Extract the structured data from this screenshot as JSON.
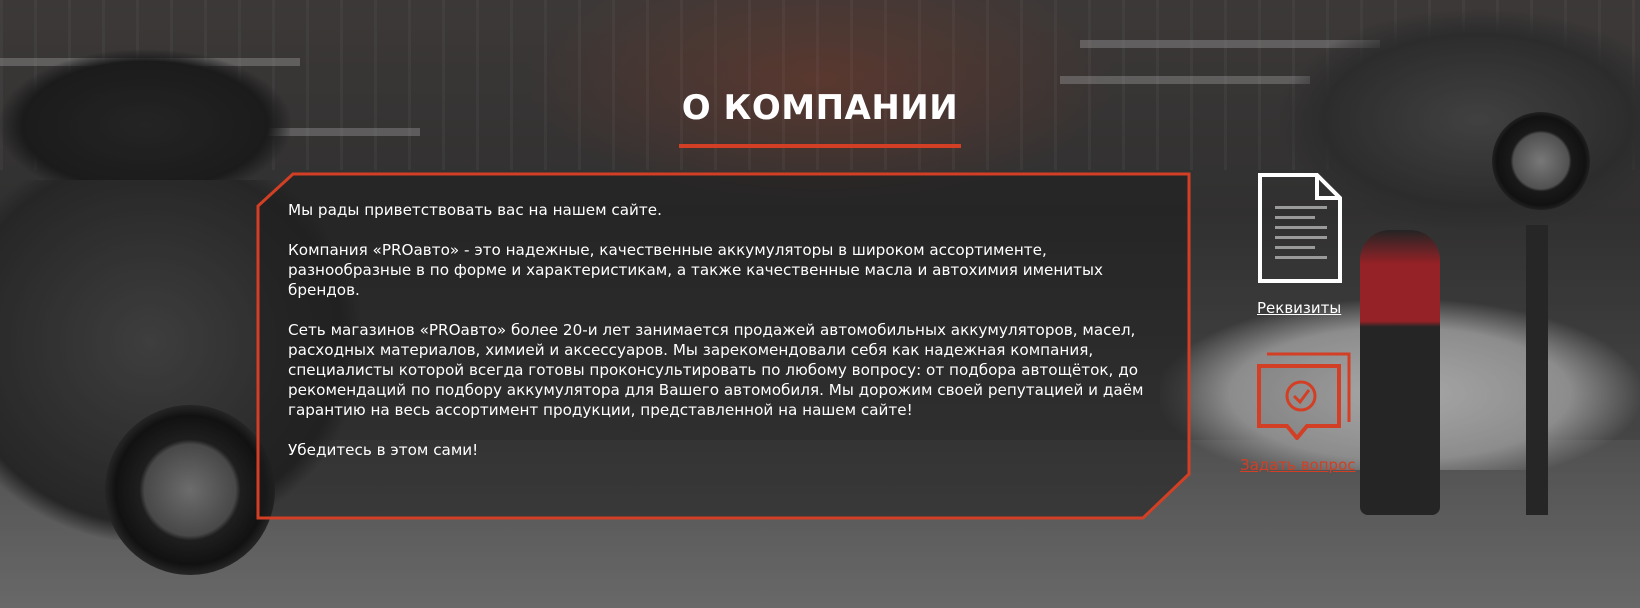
{
  "page": {
    "title": "О КОМПАНИИ"
  },
  "about": {
    "paragraphs": [
      "Мы рады приветствовать вас на нашем сайте.",
      "Компания «PROавто» - это надежные, качественные аккумуляторы в широком ассортименте, разнообразные в по форме и характеристикам, а также качественные масла и автохимия именитых брендов.",
      "Сеть магазинов «PROавто» более 20-и лет занимается продажей автомобильных аккумуляторов, масел, расходных материалов, химией и аксессуаров. Мы зарекомендовали себя как надежная компания, специалисты которой всегда готовы проконсультировать по любому вопросу: от подбора автощёток, до рекомендаций по подбору аккумулятора для Вашего автомобиля. Мы дорожим своей репутацией и даём гарантию на весь ассортимент продукции, представленной на нашем сайте!",
      "Убедитесь в этом сами!"
    ]
  },
  "side": {
    "requisites_label": "Реквизиты",
    "requisites_icon": "document-icon",
    "ask_label": "Задать вопрос",
    "ask_icon": "chat-check-icon"
  },
  "colors": {
    "accent": "#d23f24",
    "text": "#ffffff",
    "panel_bg": "rgba(30,30,30,0.55)"
  }
}
